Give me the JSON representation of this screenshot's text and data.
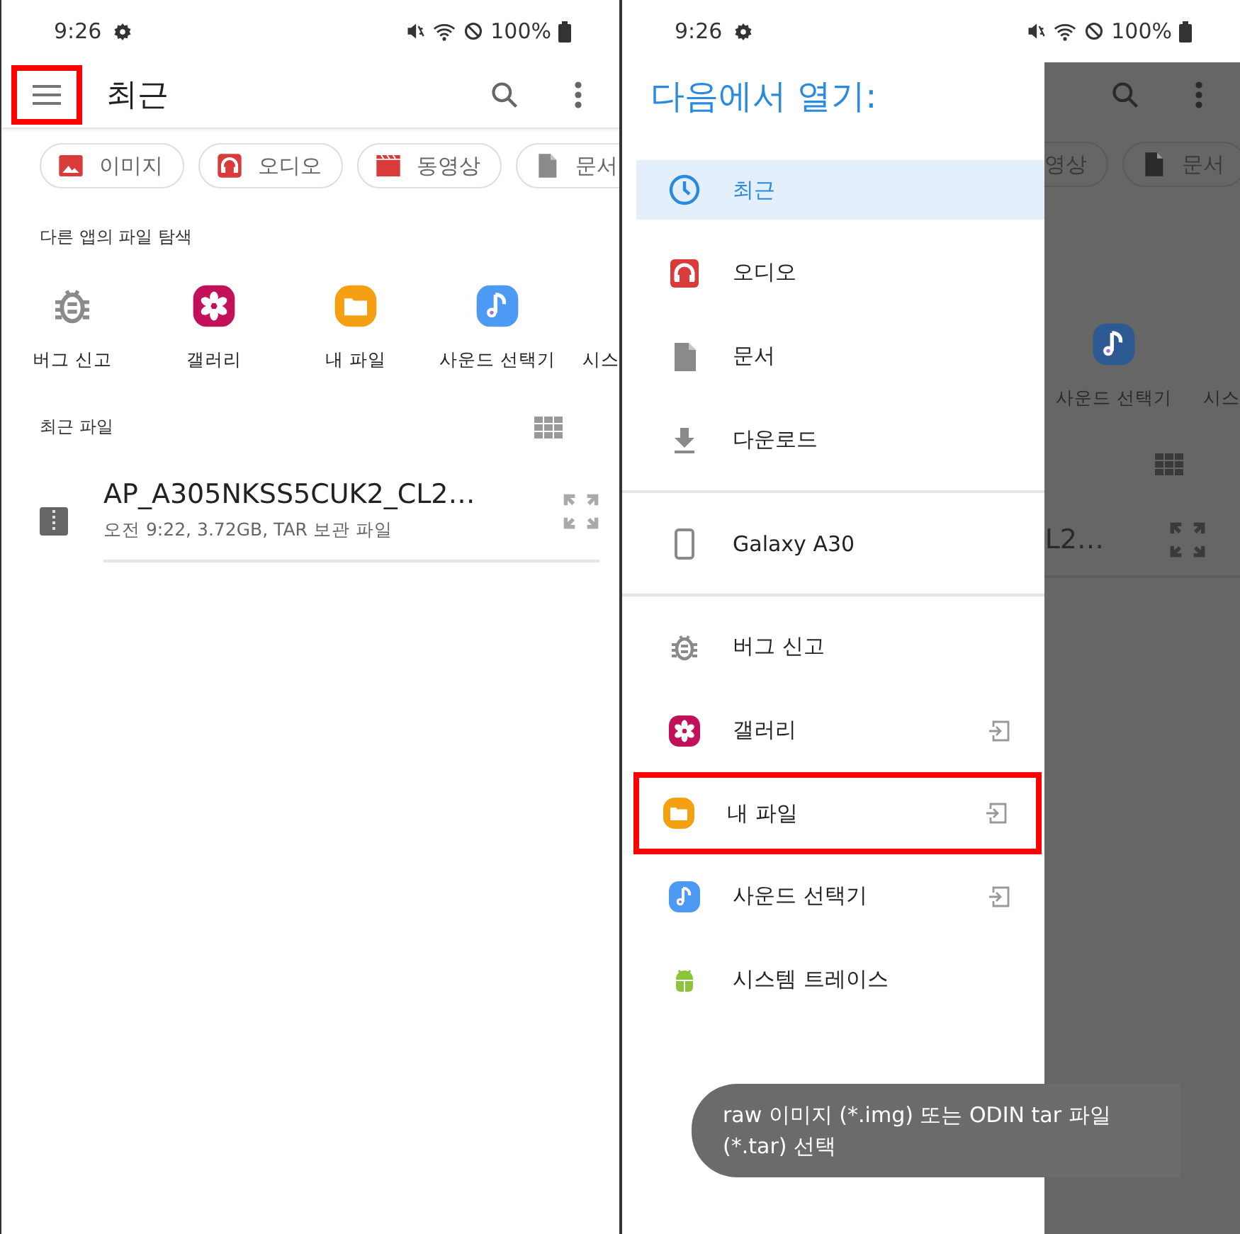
{
  "left_screen": {
    "status_bar": {
      "time": "9:26",
      "battery": "100%"
    },
    "toolbar": {
      "title": "최근",
      "menu_highlighted": true
    },
    "chips": [
      {
        "label": "이미지",
        "kind": "image"
      },
      {
        "label": "오디오",
        "kind": "audio"
      },
      {
        "label": "동영상",
        "kind": "video"
      },
      {
        "label": "문서",
        "kind": "document"
      }
    ],
    "apps_title": "다른 앱의 파일 탐색",
    "apps": [
      {
        "label": "버그 신고",
        "kind": "bug"
      },
      {
        "label": "갤러리",
        "kind": "gallery"
      },
      {
        "label": "내 파일",
        "kind": "files"
      },
      {
        "label": "사운드 선택기",
        "kind": "sound"
      },
      {
        "label": "시스",
        "kind": "none"
      }
    ],
    "recent_title": "최근 파일",
    "files": [
      {
        "name": "AP_A305NKSS5CUK2_CL2…",
        "details": "오전 9:22, 3.72GB, TAR 보관 파일"
      }
    ]
  },
  "right_screen": {
    "status_bar": {
      "time": "9:26",
      "battery": "100%"
    },
    "backdrop": {
      "chips": [
        {
          "label": "영상",
          "cut": true
        },
        {
          "label": "문서",
          "kind": "document",
          "cut": false
        }
      ],
      "apps": [
        {
          "label": "사운드 선택기",
          "kind": "sound"
        },
        {
          "label": "시스",
          "kind": "none"
        }
      ],
      "file_fragment": "L2…"
    },
    "drawer": {
      "title": "다음에서 열기:",
      "sections": [
        {
          "items": [
            {
              "label": "최근",
              "kind": "recent",
              "selected": true,
              "highlighted": false,
              "launch": false
            },
            {
              "label": "오디오",
              "kind": "audio",
              "selected": false,
              "highlighted": false,
              "launch": false
            },
            {
              "label": "문서",
              "kind": "document",
              "selected": false,
              "highlighted": false,
              "launch": false
            },
            {
              "label": "다운로드",
              "kind": "download",
              "selected": false,
              "highlighted": false,
              "launch": false
            }
          ]
        },
        {
          "items": [
            {
              "label": "Galaxy A30",
              "kind": "phone",
              "selected": false,
              "highlighted": false,
              "launch": false
            }
          ]
        },
        {
          "items": [
            {
              "label": "버그 신고",
              "kind": "bug",
              "selected": false,
              "highlighted": false,
              "launch": false
            },
            {
              "label": "갤러리",
              "kind": "gallery",
              "selected": false,
              "highlighted": false,
              "launch": true
            },
            {
              "label": "내 파일",
              "kind": "files",
              "selected": false,
              "highlighted": true,
              "launch": true
            },
            {
              "label": "사운드 선택기",
              "kind": "sound",
              "selected": false,
              "highlighted": false,
              "launch": true
            },
            {
              "label": "시스템 트레이스",
              "kind": "android",
              "selected": false,
              "highlighted": false,
              "launch": false
            }
          ]
        }
      ]
    },
    "toast": "raw 이미지 (*.img) 또는 ODIN tar 파일 (*.tar) 선택"
  }
}
